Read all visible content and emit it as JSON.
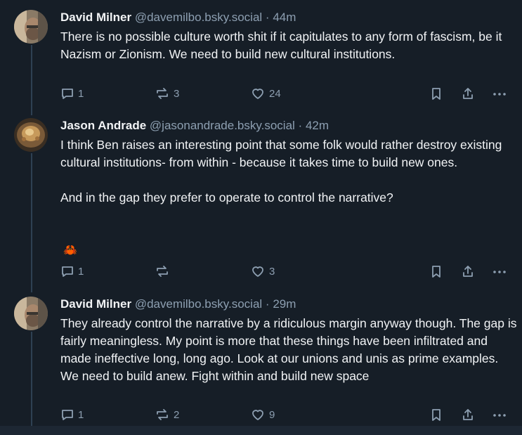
{
  "posts": [
    {
      "author_name": "David Milner",
      "handle": "@davemilbo.bsky.social",
      "separator": "·",
      "time": "44m",
      "text": "There is no possible culture worth shit if it capitulates to any form of fascism, be it Nazism or Zionism. We need to build new cultural institutions.",
      "replies": "1",
      "reposts": "3",
      "likes": "24"
    },
    {
      "author_name": "Jason Andrade",
      "handle": "@jasonandrade.bsky.social",
      "separator": "·",
      "time": "42m",
      "text": "I think Ben raises an interesting point that some folk would rather destroy existing cultural institutions- from within - because it takes time to build new ones.\n\nAnd in the gap they prefer to operate to control the narrative?",
      "emoji": "🦀",
      "replies": "1",
      "reposts": "",
      "likes": "3"
    },
    {
      "author_name": "David Milner",
      "handle": "@davemilbo.bsky.social",
      "separator": "·",
      "time": "29m",
      "text": "They already control the narrative by a ridiculous margin anyway though. The gap is fairly meaningless. My point is more that these things have been infiltrated and made ineffective long, long ago. Look at our unions and unis as prime examples. We need to build anew. Fight within and build new space",
      "replies": "1",
      "reposts": "2",
      "likes": "9"
    }
  ],
  "icons": {
    "reply": "reply-icon",
    "repost": "repost-icon",
    "like": "heart-icon",
    "bookmark": "bookmark-icon",
    "share": "share-icon",
    "more": "more-icon"
  },
  "colors": {
    "background": "#161e27",
    "text": "#f1f3f5",
    "muted": "#8d9fb1",
    "thread_line": "#2e4052"
  }
}
